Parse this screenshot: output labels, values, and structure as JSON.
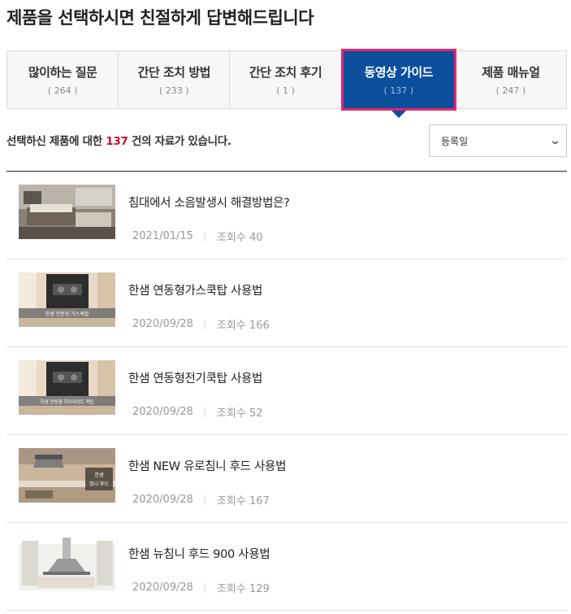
{
  "page_title": "제품을 선택하시면 친절하게 답변해드립니다",
  "tabs": [
    {
      "label": "많이하는 질문",
      "count": "( 264 )",
      "active": false
    },
    {
      "label": "간단 조치 방법",
      "count": "( 233 )",
      "active": false
    },
    {
      "label": "간단 조치 후기",
      "count": "( 1 )",
      "active": false
    },
    {
      "label": "동영상 가이드",
      "count": "( 137 )",
      "active": true
    },
    {
      "label": "제품 매뉴얼",
      "count": "( 247 )",
      "active": false
    }
  ],
  "result": {
    "prefix": "선택하신 제품에 대한 ",
    "count": "137",
    "suffix": " 건의 자료가 있습니다."
  },
  "sort": {
    "selected": "등록일"
  },
  "items": [
    {
      "title": "침대에서 소음발생시 해결방법은?",
      "date": "2021/01/15",
      "views": "조회수 40",
      "thumb": "bedroom"
    },
    {
      "title": "한샘 연동형가스쿡탑 사용법",
      "date": "2020/09/28",
      "views": "조회수 166",
      "thumb": "cooktop",
      "thumb_caption": "한샘 연동형 가스쿡탑"
    },
    {
      "title": "한샘 연동형전기쿡탑 사용법",
      "date": "2020/09/28",
      "views": "조회수 52",
      "thumb": "cooktop",
      "thumb_caption": "한샘 연동형 하이라이트 쿡탑"
    },
    {
      "title": "한샘 NEW 유로침니 후드 사용법",
      "date": "2020/09/28",
      "views": "조회수 167",
      "thumb": "hood",
      "thumb_caption_1": "한샘",
      "thumb_caption_2": "침니 후드"
    },
    {
      "title": "한샘 뉴침니 후드 900 사용법",
      "date": "2020/09/28",
      "views": "조회수 129",
      "thumb": "hood2"
    }
  ]
}
